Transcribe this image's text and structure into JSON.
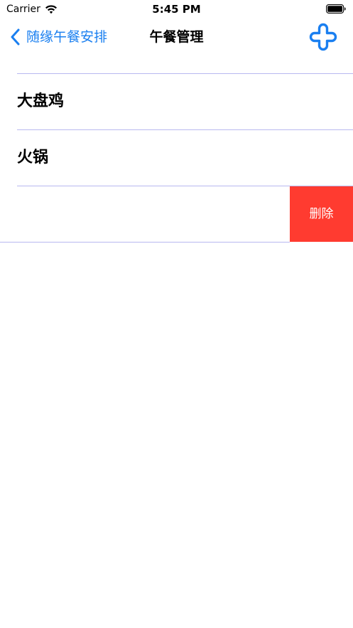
{
  "status_bar": {
    "carrier": "Carrier",
    "time": "5:45 PM",
    "wifi_icon": "wifi-icon",
    "battery_icon": "battery-full-icon"
  },
  "nav_bar": {
    "back_label": "随缘午餐安排",
    "title": "午餐管理",
    "add_icon": "plus-rounded-icon",
    "accent_color": "#1a7ff0"
  },
  "list": {
    "items": [
      {
        "label": "大盘鸡"
      },
      {
        "label": "火锅"
      },
      {
        "label": ""
      }
    ],
    "swipe_action_label": "删除",
    "swipe_action_color": "#ff3b30",
    "separator_color": "#b8b8f0"
  }
}
